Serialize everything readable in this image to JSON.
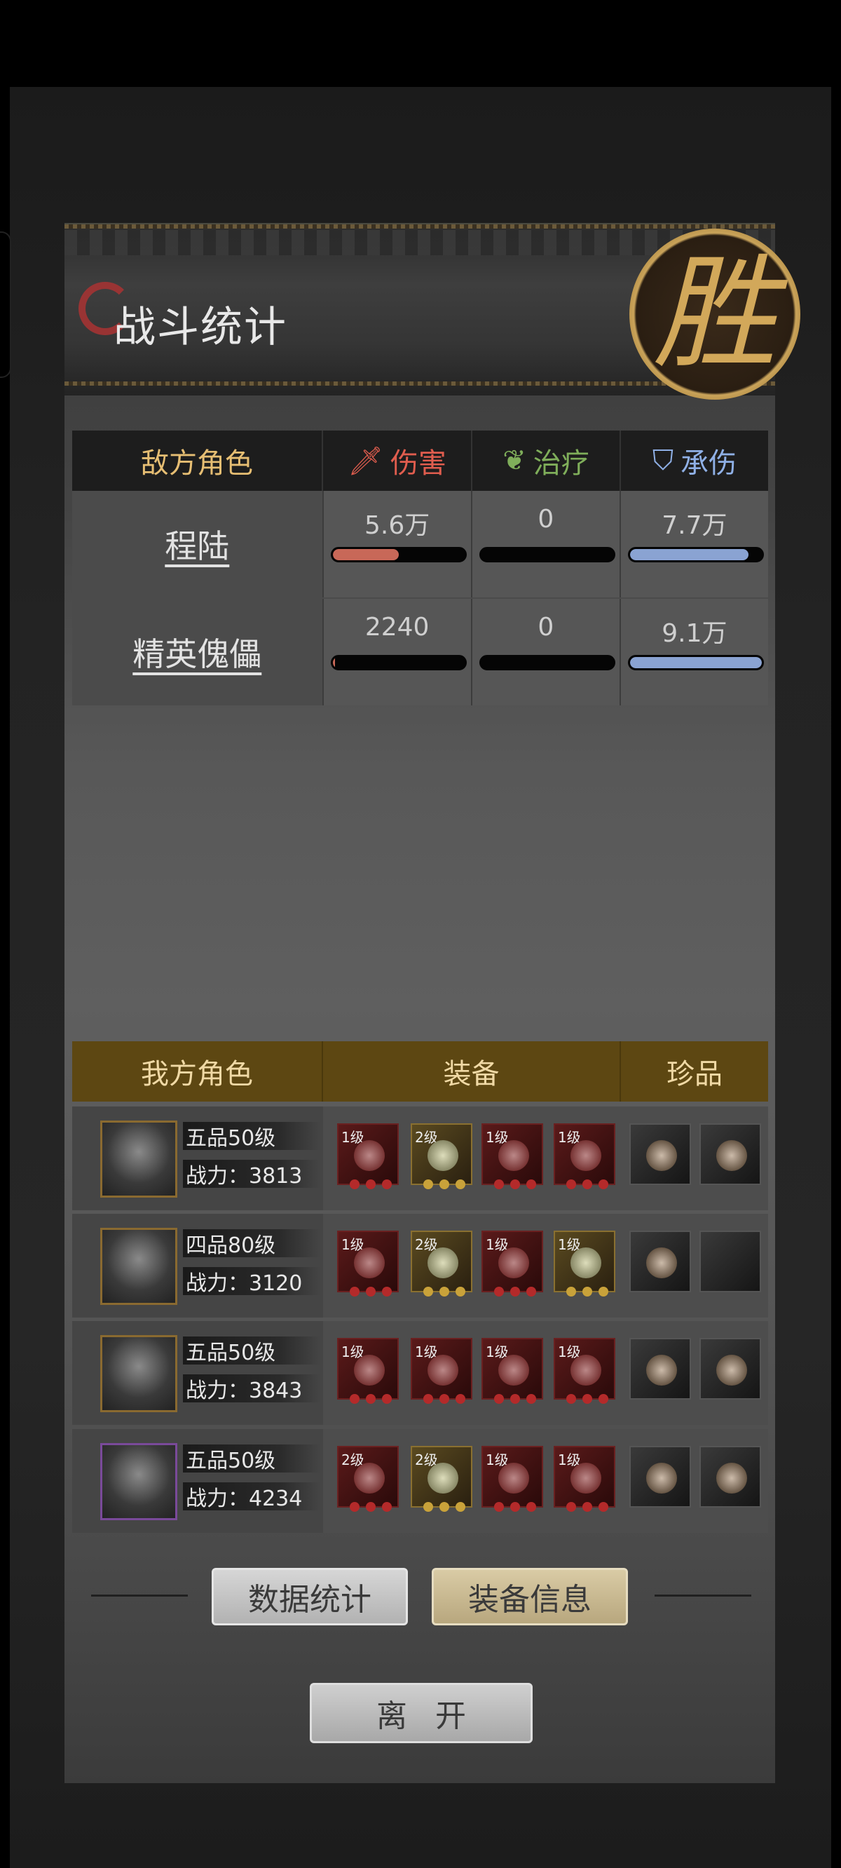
{
  "header": {
    "title": "战斗统计",
    "victory_seal": "胜"
  },
  "enemy_table": {
    "headers": {
      "role": "敌方角色",
      "damage": "伤害",
      "heal": "治疗",
      "taken": "承伤"
    },
    "rows": [
      {
        "name": "程陆",
        "damage": "5.6万",
        "heal": "0",
        "taken": "7.7万",
        "damage_fill": 0.5,
        "heal_fill": 0,
        "taken_fill": 0.9
      },
      {
        "name": "精英傀儡",
        "damage": "2240",
        "heal": "0",
        "taken": "9.1万",
        "damage_fill": 0.02,
        "heal_fill": 0,
        "taken_fill": 1.0
      }
    ],
    "colors": {
      "damage": "#c86858",
      "taken": "#8aa3d2"
    }
  },
  "ally_table": {
    "headers": {
      "role": "我方角色",
      "equipment": "装备",
      "treasure": "珍品"
    },
    "rows": [
      {
        "rank": "五品50级",
        "power": "战力：3813",
        "equip_levels": [
          "1级",
          "2级",
          "1级",
          "1级"
        ]
      },
      {
        "rank": "四品80级",
        "power": "战力：3120",
        "equip_levels": [
          "1级",
          "2级",
          "1级",
          "1级"
        ]
      },
      {
        "rank": "五品50级",
        "power": "战力：3843",
        "equip_levels": [
          "1级",
          "1级",
          "1级",
          "1级"
        ]
      },
      {
        "rank": "五品50级",
        "power": "战力：4234",
        "equip_levels": [
          "2级",
          "2级",
          "1级",
          "1级"
        ]
      }
    ]
  },
  "buttons": {
    "stats": "数据统计",
    "equip_info": "装备信息",
    "leave": "离开"
  }
}
